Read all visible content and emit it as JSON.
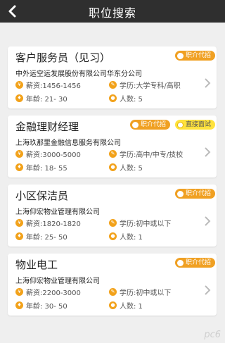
{
  "header": {
    "title": "职位搜索",
    "back_icon": "back-chevron-icon"
  },
  "jobs": [
    {
      "title": "客户服务员（见习）",
      "company": "中外运空运发展股份有限公司华东分公司",
      "salary": "薪资:1456-1456",
      "education": "学历:大学专科/高职",
      "age": "年龄: 21- 30",
      "headcount": "人数:  5",
      "tags": [
        "职介代招"
      ]
    },
    {
      "title": "金融理财经理",
      "company": "上海玖那里金融信息服务有限公司",
      "salary": "薪资:3000-5000",
      "education": "学历:高中/中专/技校",
      "age": "年龄: 18- 55",
      "headcount": "人数:  5",
      "tags": [
        "职介代招",
        "直接面试"
      ]
    },
    {
      "title": "小区保洁员",
      "company": "上海仰宏物业管理有限公司",
      "salary": "薪资:1820-1820",
      "education": "学历:初中或以下",
      "age": "年龄: 25- 50",
      "headcount": "人数:  1",
      "tags": [
        "职介代招"
      ]
    },
    {
      "title": "物业电工",
      "company": "上海仰宏物业管理有限公司",
      "salary": "薪资:2200-3000",
      "education": "学历:初中或以下",
      "age": "年龄: 30- 50",
      "headcount": "人数:  1",
      "tags": [
        "职介代招"
      ]
    }
  ],
  "watermark": "pc6",
  "colors": {
    "header_bg": "#2f2f2f",
    "accent_orange": "#f0a022",
    "accent_yellow": "#ffe23d",
    "page_bg": "#efefef"
  }
}
